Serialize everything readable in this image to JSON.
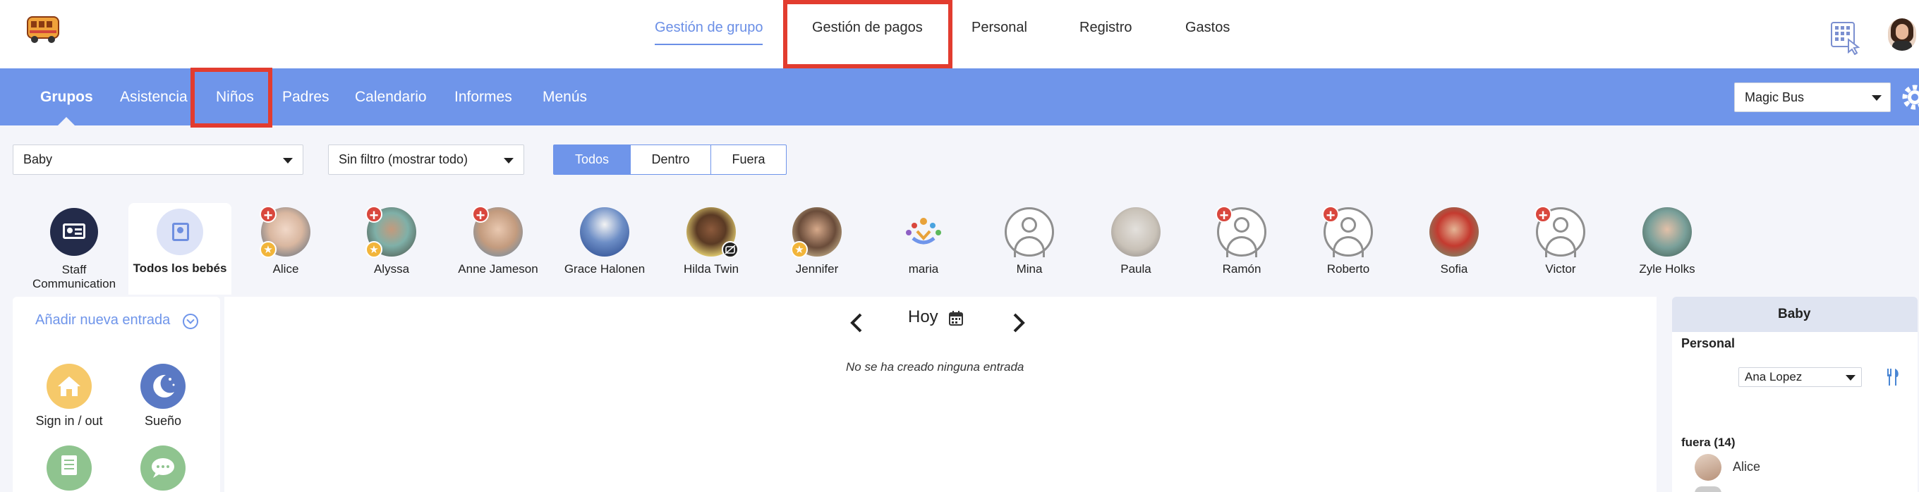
{
  "top_nav": {
    "items": [
      "Gestión de grupo",
      "Gestión de pagos",
      "Personal",
      "Registro",
      "Gastos"
    ],
    "active": "Gestión de grupo"
  },
  "sub_nav": {
    "items": [
      "Grupos",
      "Asistencia",
      "Niños",
      "Padres",
      "Calendario",
      "Informes",
      "Menús"
    ],
    "active": "Grupos",
    "school_select": "Magic Bus"
  },
  "filters": {
    "group_select": "Baby",
    "filter_select": "Sin filtro (mostrar todo)",
    "segments": [
      "Todos",
      "Dentro",
      "Fuera"
    ],
    "active_segment": "Todos"
  },
  "special_tabs": {
    "staff_label": "Staff Communication",
    "all_label": "Todos los bebés"
  },
  "children": [
    {
      "name": "Alice",
      "plus": true,
      "star": true
    },
    {
      "name": "Alyssa",
      "plus": true,
      "star": true
    },
    {
      "name": "Anne Jameson",
      "plus": true,
      "star": false
    },
    {
      "name": "Grace Halonen",
      "plus": false,
      "star": false
    },
    {
      "name": "Hilda Twin",
      "plus": false,
      "star": false
    },
    {
      "name": "Jennifer",
      "plus": false,
      "star": true
    },
    {
      "name": "maria",
      "plus": false,
      "star": false
    },
    {
      "name": "Mina",
      "plus": false,
      "star": false
    },
    {
      "name": "Paula",
      "plus": false,
      "star": false
    },
    {
      "name": "Ramón",
      "plus": true,
      "star": false
    },
    {
      "name": "Roberto",
      "plus": true,
      "star": false
    },
    {
      "name": "Sofia",
      "plus": false,
      "star": false
    },
    {
      "name": "Victor",
      "plus": true,
      "star": false
    },
    {
      "name": "Zyle Holks",
      "plus": false,
      "star": false
    }
  ],
  "entries": {
    "add_label": "Añadir nueva entrada",
    "actions": [
      "Sign in / out",
      "Sueño"
    ]
  },
  "feed": {
    "date_label": "Hoy",
    "empty_message": "No se ha creado ninguna entrada"
  },
  "side_panel": {
    "title": "Baby",
    "personal_label": "Personal",
    "staff_select": "Ana Lopez",
    "out_label": "fuera (14)",
    "out_first": "Alice"
  },
  "colors": {
    "accent": "#6f95ea",
    "highlight": "#e23c2f"
  }
}
